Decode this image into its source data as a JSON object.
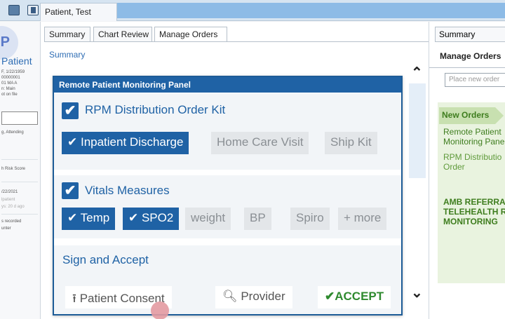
{
  "window": {
    "patient_tab": "Patient, Test"
  },
  "sidebar": {
    "avatar_initials": "P",
    "name": "Patient",
    "details": [
      "F, 1/22/1959",
      "00000001",
      "01 MA A",
      "n: Main",
      "ot on file"
    ],
    "attending": "g, Attending",
    "risk": "h Risk Score",
    "date": "/22/2021",
    "sub1": "lpatient",
    "sub2": "ys: 20 d ago",
    "rec1": "s recorded",
    "rec2": "unter"
  },
  "main": {
    "tabs": [
      "Summary",
      "Chart Review",
      "Manage Orders"
    ],
    "summary_link": "Summary"
  },
  "modal": {
    "title": "Remote Patient Monitoring Panel",
    "kit": {
      "checked": true,
      "label": "RPM Distribution Order Kit",
      "options": [
        {
          "label": "Inpatient Discharge",
          "selected": true
        },
        {
          "label": "Home Care Visit",
          "selected": false
        },
        {
          "label": "Ship Kit",
          "selected": false
        }
      ]
    },
    "vitals": {
      "checked": true,
      "label": "Vitals Measures",
      "options": [
        {
          "label": "Temp",
          "selected": true
        },
        {
          "label": "SPO2",
          "selected": true
        },
        {
          "label": "weight",
          "selected": false
        },
        {
          "label": "BP",
          "selected": false
        },
        {
          "label": "Spiro",
          "selected": false
        },
        {
          "label": "+ more",
          "selected": false
        }
      ]
    },
    "sign": {
      "label": "Sign and Accept",
      "consent_label": "Patient Consent",
      "provider_label": "Provider",
      "accept_label": "ACCEPT"
    }
  },
  "right_panel": {
    "tab": "Summary",
    "title": "Manage Orders",
    "search_placeholder": "Place new order",
    "new_orders": "New Orders",
    "order_title_lines": [
      "Remote Patient",
      "Monitoring Panel"
    ],
    "order_sub_lines": [
      "RPM Distributio",
      "Order"
    ],
    "referral_lines": [
      "AMB REFERRAL",
      "TELEHEALTH R",
      "MONITORING"
    ]
  },
  "colors": {
    "accent": "#1f62a5",
    "accept": "#2f8a2f",
    "order_green": "#3e7d1e"
  }
}
